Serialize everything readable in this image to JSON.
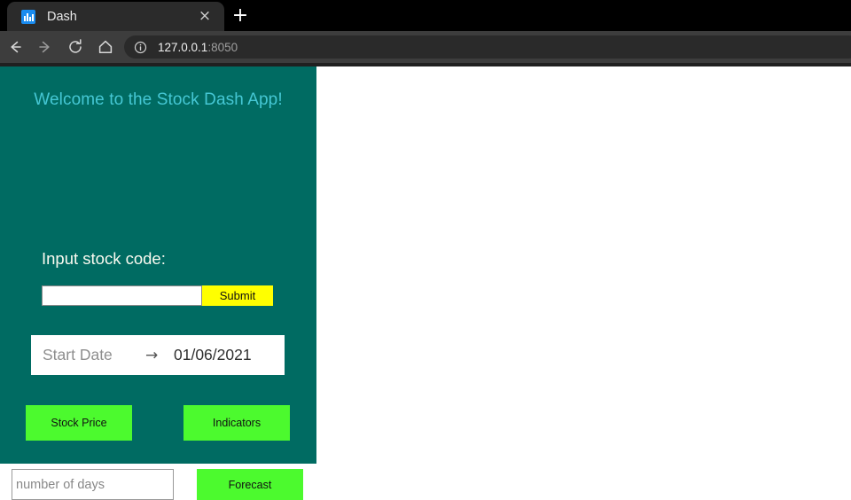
{
  "browser": {
    "tab": {
      "title": "Dash",
      "favicon_name": "bar-chart-favicon",
      "close_glyph": "×"
    },
    "new_tab_glyph": "+",
    "nav": {
      "back_label": "Back",
      "forward_label": "Forward",
      "reload_label": "Reload",
      "home_label": "Home"
    },
    "address_bar": {
      "info_icon": "site-info-icon",
      "host": "127.0.0.1",
      "port": ":8050",
      "full_url": "127.0.0.1:8050"
    },
    "colors": {
      "tabstrip_bg": "#000000",
      "toolbar_bg": "#3d3d3d",
      "omnibox_bg": "#2a2a2a",
      "tab_bg": "#2b2b2b"
    }
  },
  "app": {
    "title": "Welcome to the Stock Dash App!",
    "stock_code": {
      "label": "Input stock code:",
      "value": "",
      "placeholder": "",
      "submit_label": "Submit"
    },
    "date_range": {
      "start_placeholder": "Start Date",
      "arrow_glyph": "→",
      "end_value": "01/06/2021"
    },
    "actions": {
      "stock_price_label": "Stock Price",
      "indicators_label": "Indicators",
      "forecast_label": "Forecast"
    },
    "forecast_days": {
      "placeholder": "number of days",
      "value": ""
    },
    "colors": {
      "sidebar_bg": "#006B62",
      "title_text": "#45C7D4",
      "label_text": "#FAFAF0",
      "submit_yellow": "#FFFF00",
      "action_green": "#4CFA2E",
      "content_bg": "#FFFFFF"
    }
  }
}
